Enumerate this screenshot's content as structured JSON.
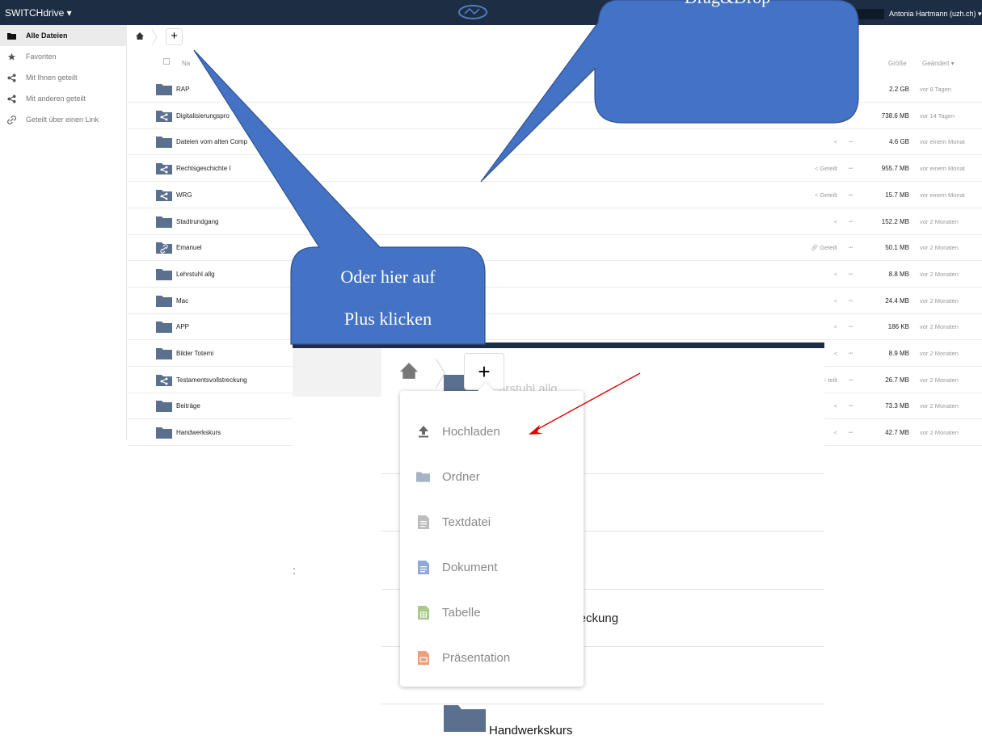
{
  "app": {
    "title": "SWITCHdrive ▾",
    "user": "Antonia Hartmann (uzh.ch) ▾"
  },
  "sidebar": {
    "items": [
      {
        "label": "Alle Dateien",
        "icon": "folder-icon",
        "active": true
      },
      {
        "label": "Favoriten",
        "icon": "star-icon"
      },
      {
        "label": "Mit Ihnen geteilt",
        "icon": "share-icon"
      },
      {
        "label": "Mit anderen geteilt",
        "icon": "share-icon"
      },
      {
        "label": "Geteilt über einen Link",
        "icon": "link-icon"
      }
    ]
  },
  "toolbar": {
    "new_label": "+"
  },
  "table": {
    "headers": {
      "name": "Na",
      "size": "Größe",
      "modified": "Geändert ▾"
    },
    "rows": [
      {
        "name": "RAP",
        "icon": "folder",
        "share": "",
        "size": "2.2 GB",
        "modified": "vor 8 Tagen"
      },
      {
        "name": "Digitalisierungspro",
        "icon": "shared-folder",
        "share": "",
        "size": "738.6 MB",
        "modified": "vor 14 Tagen"
      },
      {
        "name": "Dateien vom alten Comp",
        "icon": "folder",
        "share": "",
        "size": "4.6 GB",
        "modified": "vor einem Monat"
      },
      {
        "name": "Rechtsgeschichte I",
        "icon": "shared-folder",
        "share": "Geteilt",
        "size": "955.7 MB",
        "modified": "vor einem Monat"
      },
      {
        "name": "WRG",
        "icon": "shared-folder",
        "share": "Geteilt",
        "size": "15.7 MB",
        "modified": "vor einem Monat"
      },
      {
        "name": "Stadtrundgang",
        "icon": "folder",
        "share": "",
        "size": "152.2 MB",
        "modified": "vor 2 Monaten"
      },
      {
        "name": "Emanuel",
        "icon": "link-folder",
        "share": "Geteilt",
        "size": "50.1 MB",
        "modified": "vor 2 Monaten"
      },
      {
        "name": "Lehrstuhl allg",
        "icon": "folder",
        "share": "",
        "size": "8.8 MB",
        "modified": "vor 2 Monaten"
      },
      {
        "name": "Mac",
        "icon": "folder",
        "share": "",
        "size": "24.4 MB",
        "modified": "vor 2 Monaten"
      },
      {
        "name": "APP",
        "icon": "folder",
        "share": "",
        "size": "186 KB",
        "modified": "vor 2 Monaten"
      },
      {
        "name": "Bilder Totemi",
        "icon": "folder",
        "share": "",
        "size": "8.9 MB",
        "modified": "vor 2 Monaten"
      },
      {
        "name": "Testamentsvollstreckung",
        "icon": "shared-folder",
        "share": "teilt",
        "size": "26.7 MB",
        "modified": "vor 2 Monaten"
      },
      {
        "name": "Beiträge",
        "icon": "folder",
        "share": "",
        "size": "73.3 MB",
        "modified": "vor 2 Monaten"
      },
      {
        "name": "Handwerkskurs",
        "icon": "folder",
        "share": "",
        "size": "42.7 MB",
        "modified": "vor 2 Monaten"
      }
    ]
  },
  "zoom": {
    "plus_label": "+",
    "bg_lehrstuhl": "hrstuhl allg",
    "bg_testament": "streckung",
    "bg_handwerk": "Handwerkskurs",
    "colon": ":",
    "menu": [
      {
        "label": "Hochladen",
        "icon": "upload-icon"
      },
      {
        "label": "Ordner",
        "icon": "folder-icon"
      },
      {
        "label": "Textdatei",
        "icon": "text-file-icon"
      },
      {
        "label": "Dokument",
        "icon": "document-icon"
      },
      {
        "label": "Tabelle",
        "icon": "spreadsheet-icon"
      },
      {
        "label": "Präsentation",
        "icon": "presentation-icon"
      }
    ]
  },
  "annotations": {
    "dragdrop": "Drag&Drop",
    "plus_line1": "Oder hier auf",
    "plus_line2": "Plus klicken"
  },
  "colors": {
    "topbar": "#1d2d44",
    "folder": "#5b6f8f",
    "callout": "#4472c4",
    "arrow": "#e00000"
  }
}
